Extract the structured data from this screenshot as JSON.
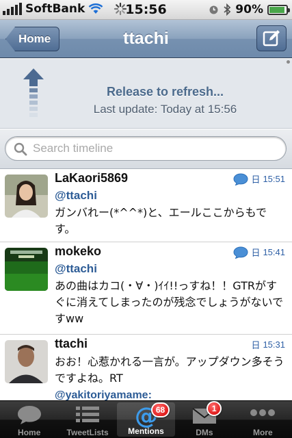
{
  "status_bar": {
    "carrier": "SoftBank",
    "time": "15:56",
    "battery": "90%",
    "battery_level": 0.9
  },
  "nav": {
    "back_label": "Home",
    "title": "ttachi",
    "compose_icon": "compose-icon"
  },
  "refresh": {
    "title": "Release to refresh...",
    "subtitle": "Last update: Today at 15:56"
  },
  "search": {
    "placeholder": "Search timeline"
  },
  "tweets": [
    {
      "name": "LaKaori5869",
      "time": "15:51",
      "day": "日",
      "mention": "@ttachi",
      "text": "ガンバれー(*^^*)と、エールここからもです。",
      "has_reply_icon": true
    },
    {
      "name": "mokeko",
      "time": "15:41",
      "day": "日",
      "mention": "@ttachi",
      "text": "あの曲はカコ(・∀・)ｲｲ!!っすね！！GTRがすぐに消えてしまったのが残念でしょうがないですww",
      "has_reply_icon": true
    },
    {
      "name": "ttachi",
      "time": "15:31",
      "day": "日",
      "mention": "",
      "text": "おお！心惹かれる一言が。アップダウン多そうですよね。RT",
      "text2": "@yakitoriyamame:",
      "has_reply_icon": false
    }
  ],
  "tabs": [
    {
      "label": "Home",
      "icon": "speech-bubble-icon",
      "badge": ""
    },
    {
      "label": "TweetLists",
      "icon": "list-icon",
      "badge": ""
    },
    {
      "label": "Mentions",
      "icon": "at-sign-icon",
      "badge": "68"
    },
    {
      "label": "DMs",
      "icon": "envelope-icon",
      "badge": "1"
    },
    {
      "label": "More",
      "icon": "more-dots-icon",
      "badge": ""
    }
  ],
  "colors": {
    "nav_blue": "#7691b0",
    "link_blue": "#2d5c96",
    "badge_red": "#d40000"
  }
}
